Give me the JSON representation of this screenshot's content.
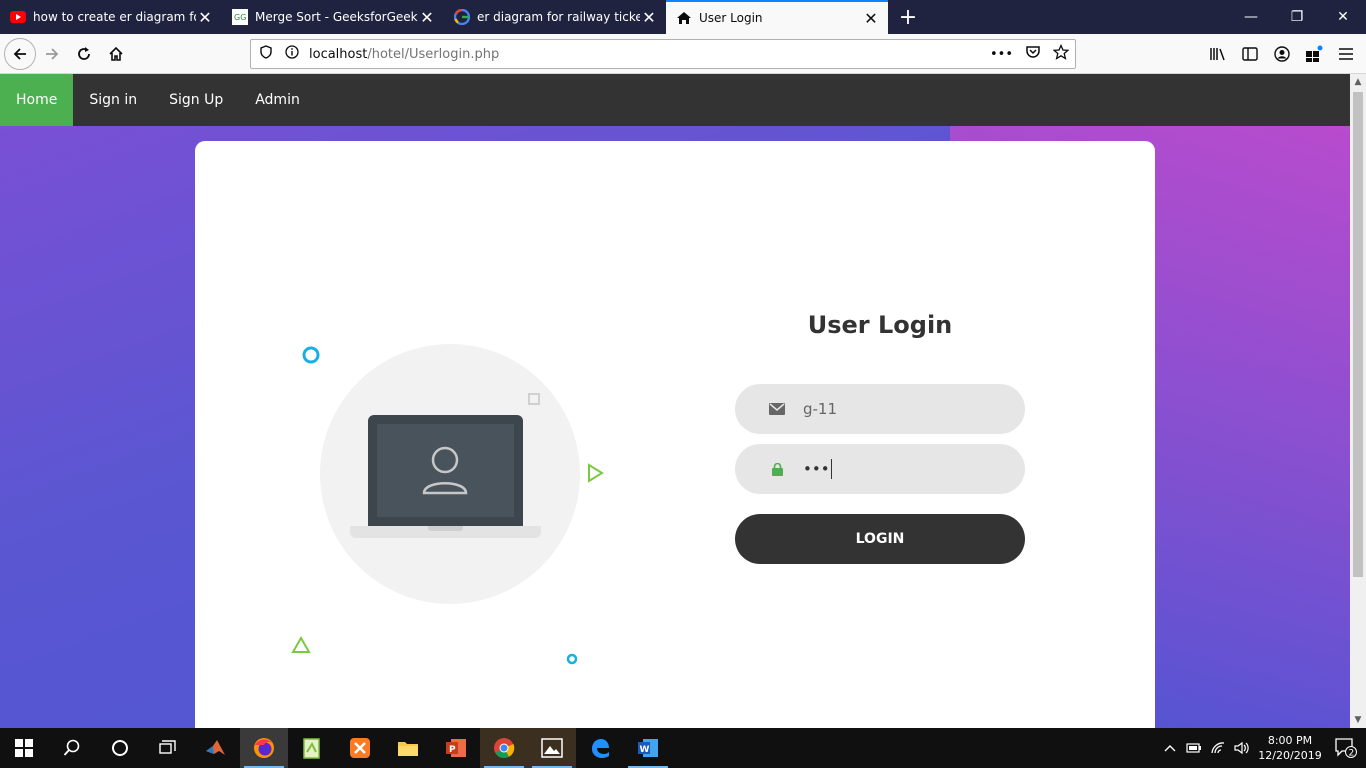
{
  "browser": {
    "tabs": [
      {
        "label": "how to create er diagram for tr",
        "icon": "youtube-icon",
        "active": false
      },
      {
        "label": "Merge Sort - GeeksforGeeks",
        "icon": "geeksforgeeks-icon",
        "active": false
      },
      {
        "label": "er diagram for railway ticket bo",
        "icon": "google-icon",
        "active": false
      },
      {
        "label": "User Login",
        "icon": "home-icon",
        "active": true
      }
    ],
    "url_host": "localhost",
    "url_path": "/hotel/Userlogin.php",
    "colors": {
      "tabbar": "#202340",
      "active_tab_accent": "#0a84ff"
    }
  },
  "site": {
    "nav": [
      {
        "label": "Home",
        "active": true
      },
      {
        "label": "Sign in",
        "active": false
      },
      {
        "label": "Sign Up",
        "active": false
      },
      {
        "label": "Admin",
        "active": false
      }
    ],
    "colors": {
      "nav_bg": "#333333",
      "nav_active": "#4caf50",
      "button_bg": "#333333"
    }
  },
  "login": {
    "title": "User Login",
    "username_value": "g-11",
    "password_masked": "•••",
    "button_label": "LOGIN"
  },
  "taskbar": {
    "time": "8:00 PM",
    "date": "12/20/2019",
    "notification_count": "2"
  }
}
